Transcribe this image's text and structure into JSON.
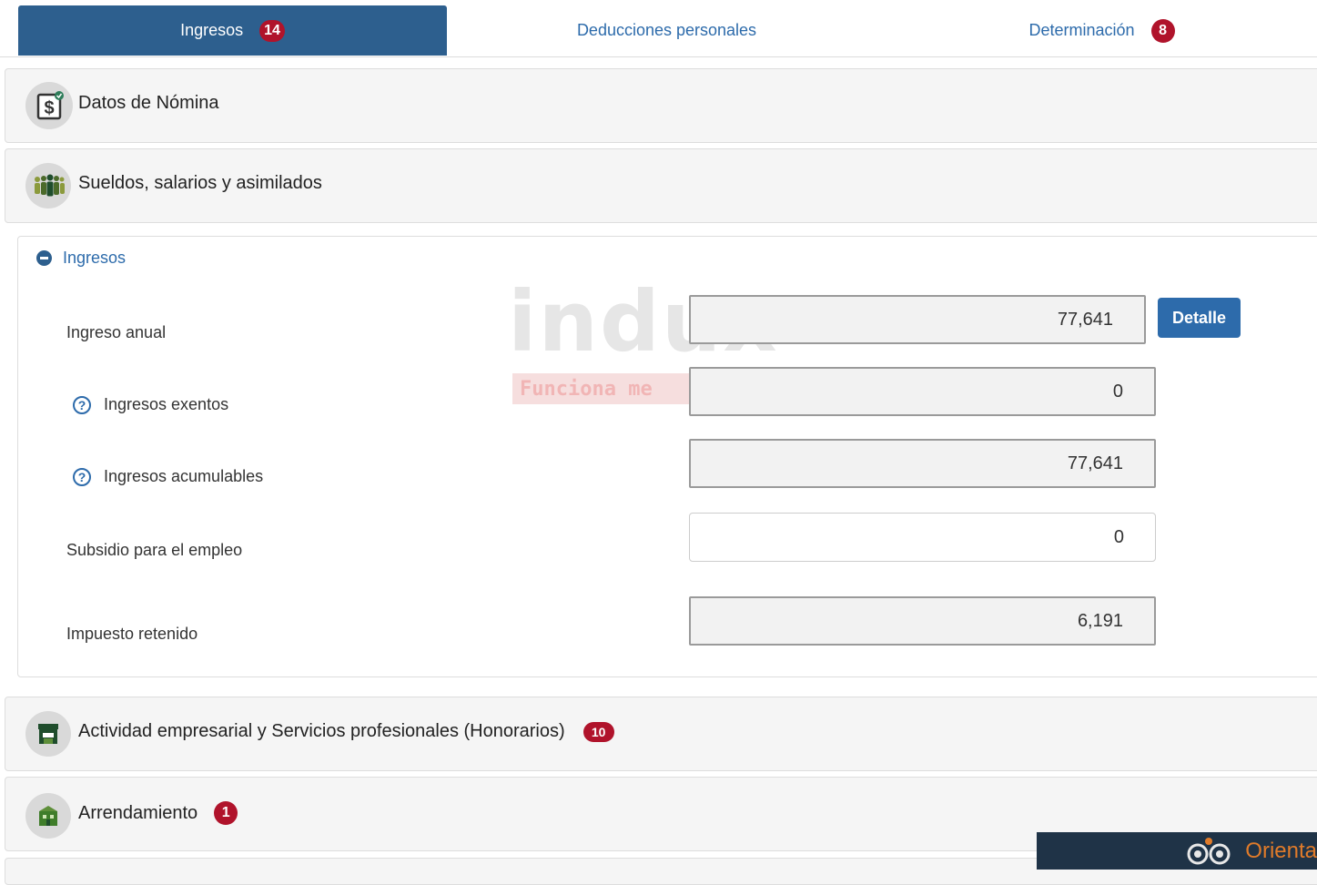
{
  "tabs": [
    {
      "label": "Ingresos",
      "badge": "14"
    },
    {
      "label": "Deducciones personales"
    },
    {
      "label": "Determinación",
      "badge": "8"
    }
  ],
  "panels": {
    "datos_nomina": {
      "title": "Datos de Nómina",
      "icon": "dollar-document-icon"
    },
    "sueldos": {
      "title": "Sueldos, salarios y asimilados",
      "icon": "people-group-icon"
    },
    "actividad": {
      "title": "Actividad empresarial y Servicios profesionales (Honorarios)",
      "badge": "10",
      "icon": "store-icon"
    },
    "arrendamiento": {
      "title": "Arrendamiento",
      "badge": "1",
      "icon": "building-icon"
    }
  },
  "ingresos_section": {
    "title": "Ingresos",
    "detail_button": "Detalle",
    "fields": [
      {
        "label": "Ingreso anual",
        "value": "77,641"
      },
      {
        "label": "Ingresos exentos",
        "value": "0"
      },
      {
        "label": "Ingresos acumulables",
        "value": "77,641"
      },
      {
        "label": "Subsidio para el empleo",
        "value": "0"
      },
      {
        "label": "Impuesto retenido",
        "value": "6,191"
      }
    ]
  },
  "watermark": {
    "main": "indux",
    "sub": "Funciona me"
  },
  "widget": {
    "label": "Orienta"
  },
  "colors": {
    "primary": "#2d5f8e",
    "link": "#2d6bab",
    "badge": "#b0132b",
    "panel_bg": "#f5f5f5"
  }
}
